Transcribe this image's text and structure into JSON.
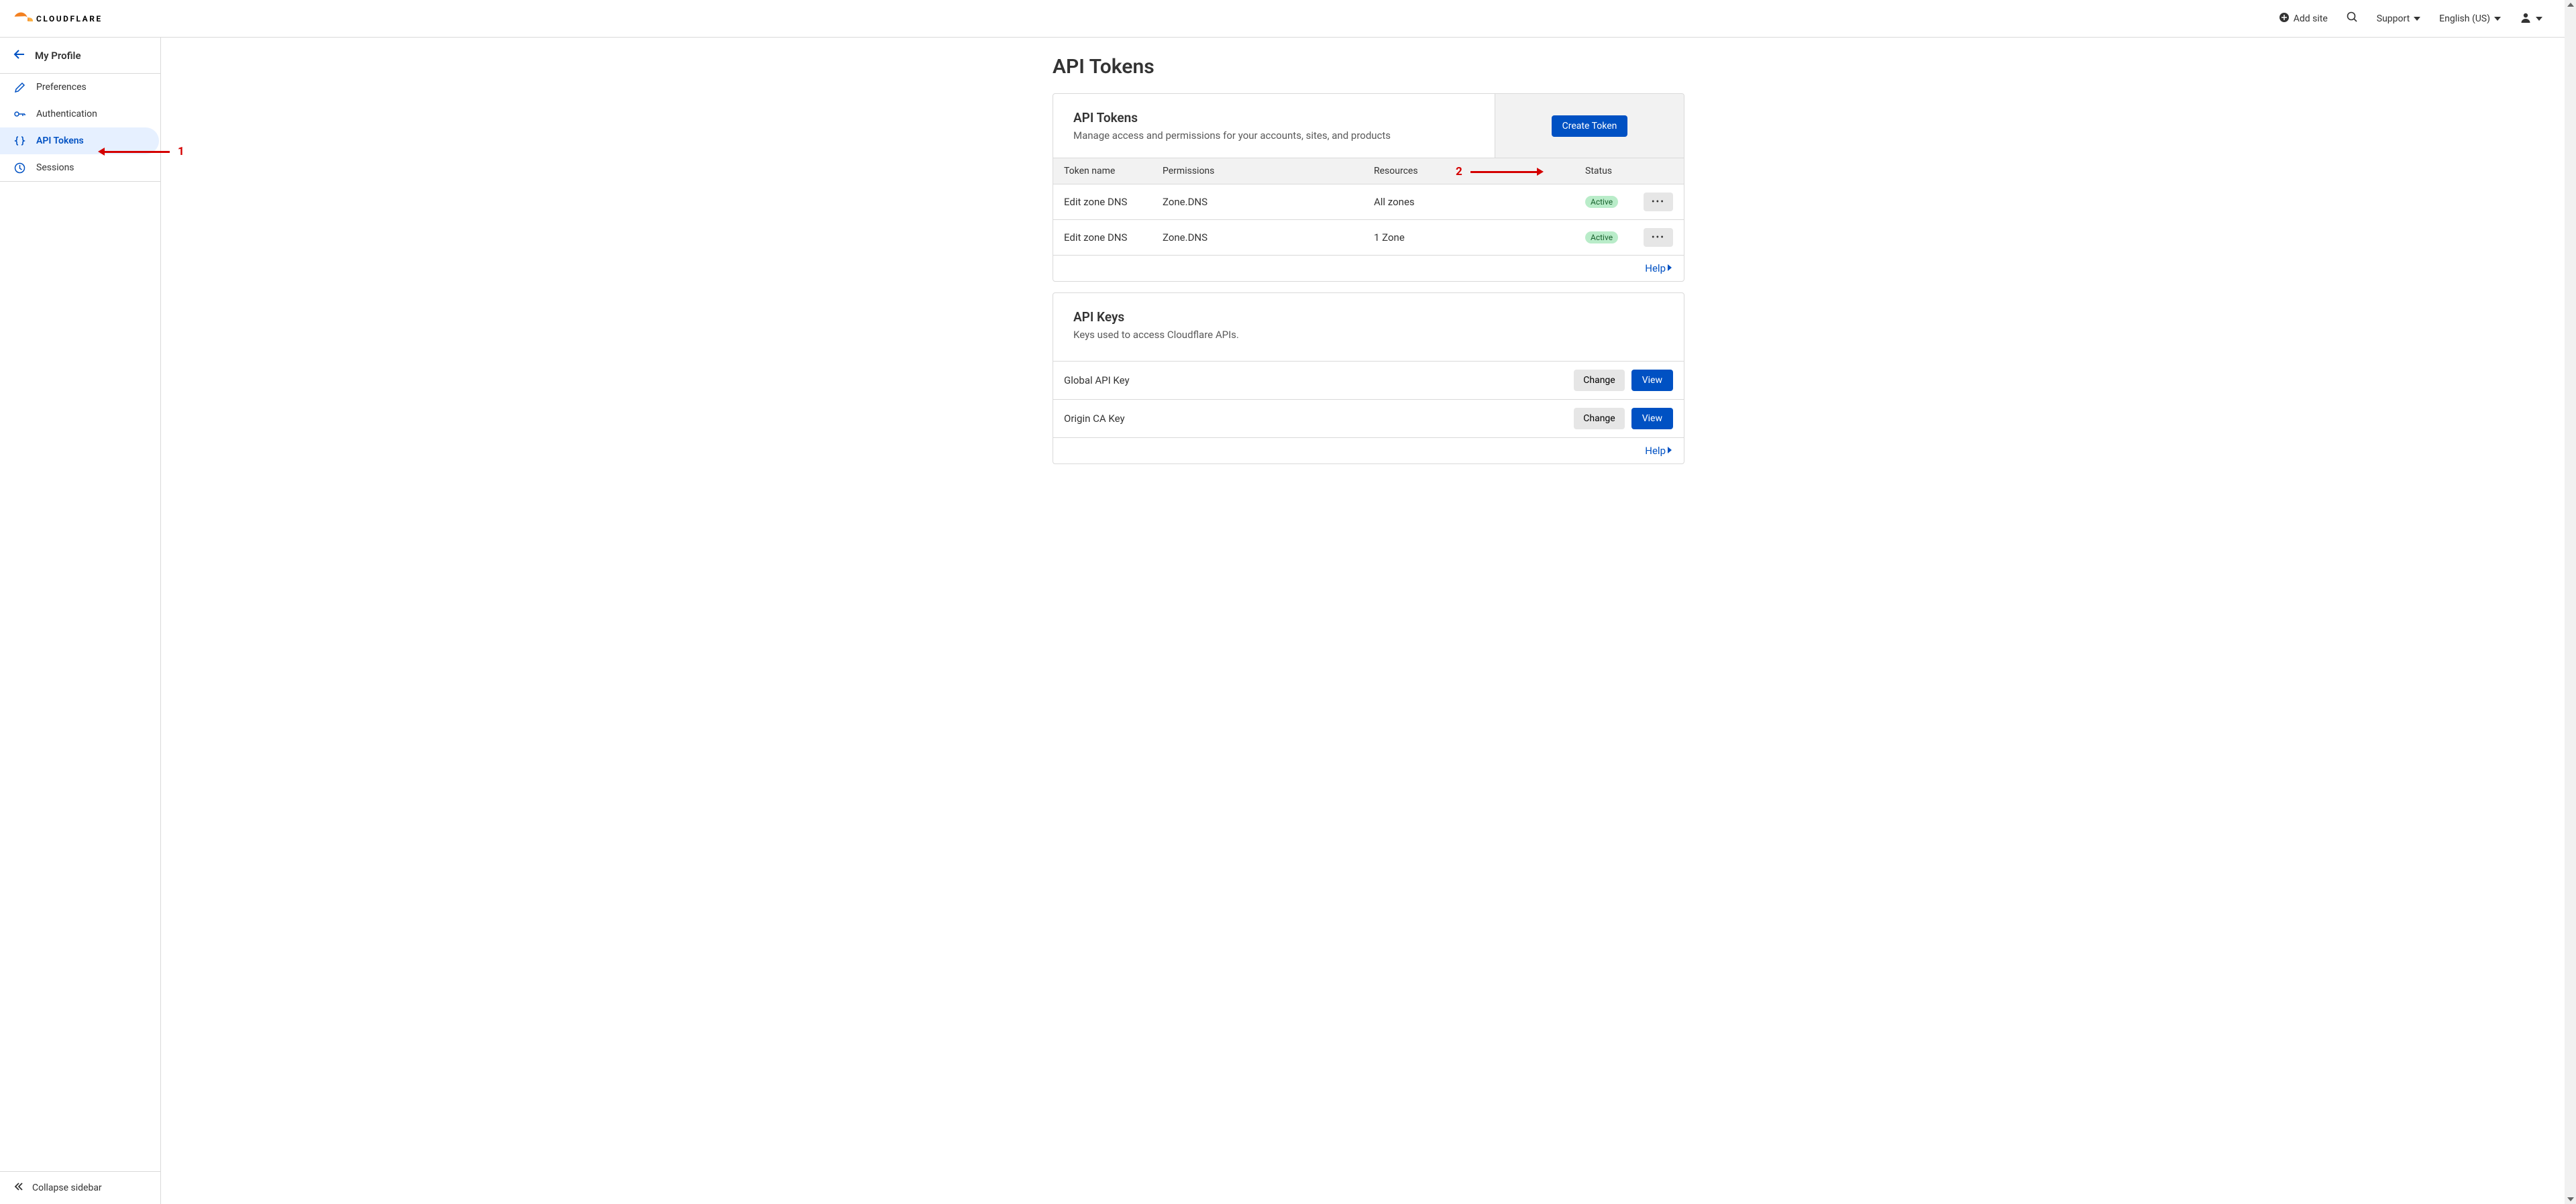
{
  "brand": "CLOUDFLARE",
  "topbar": {
    "add_site": "Add site",
    "support": "Support",
    "language": "English (US)"
  },
  "sidebar": {
    "title": "My Profile",
    "items": [
      {
        "label": "Preferences"
      },
      {
        "label": "Authentication"
      },
      {
        "label": "API Tokens"
      },
      {
        "label": "Sessions"
      }
    ],
    "collapse": "Collapse sidebar"
  },
  "page": {
    "title": "API Tokens"
  },
  "tokens_card": {
    "title": "API Tokens",
    "subtitle": "Manage access and permissions for your accounts, sites, and products",
    "create_btn": "Create Token",
    "columns": {
      "name": "Token name",
      "perm": "Permissions",
      "res": "Resources",
      "status": "Status"
    },
    "rows": [
      {
        "name": "Edit zone DNS",
        "perm": "Zone.DNS",
        "res": "All zones",
        "status": "Active"
      },
      {
        "name": "Edit zone DNS",
        "perm": "Zone.DNS",
        "res": "1 Zone",
        "status": "Active"
      }
    ],
    "help": "Help"
  },
  "keys_card": {
    "title": "API Keys",
    "subtitle": "Keys used to access Cloudflare APIs.",
    "rows": [
      {
        "name": "Global API Key",
        "change": "Change",
        "view": "View"
      },
      {
        "name": "Origin CA Key",
        "change": "Change",
        "view": "View"
      }
    ],
    "help": "Help"
  },
  "annotations": {
    "num1": "1",
    "num2": "2"
  }
}
